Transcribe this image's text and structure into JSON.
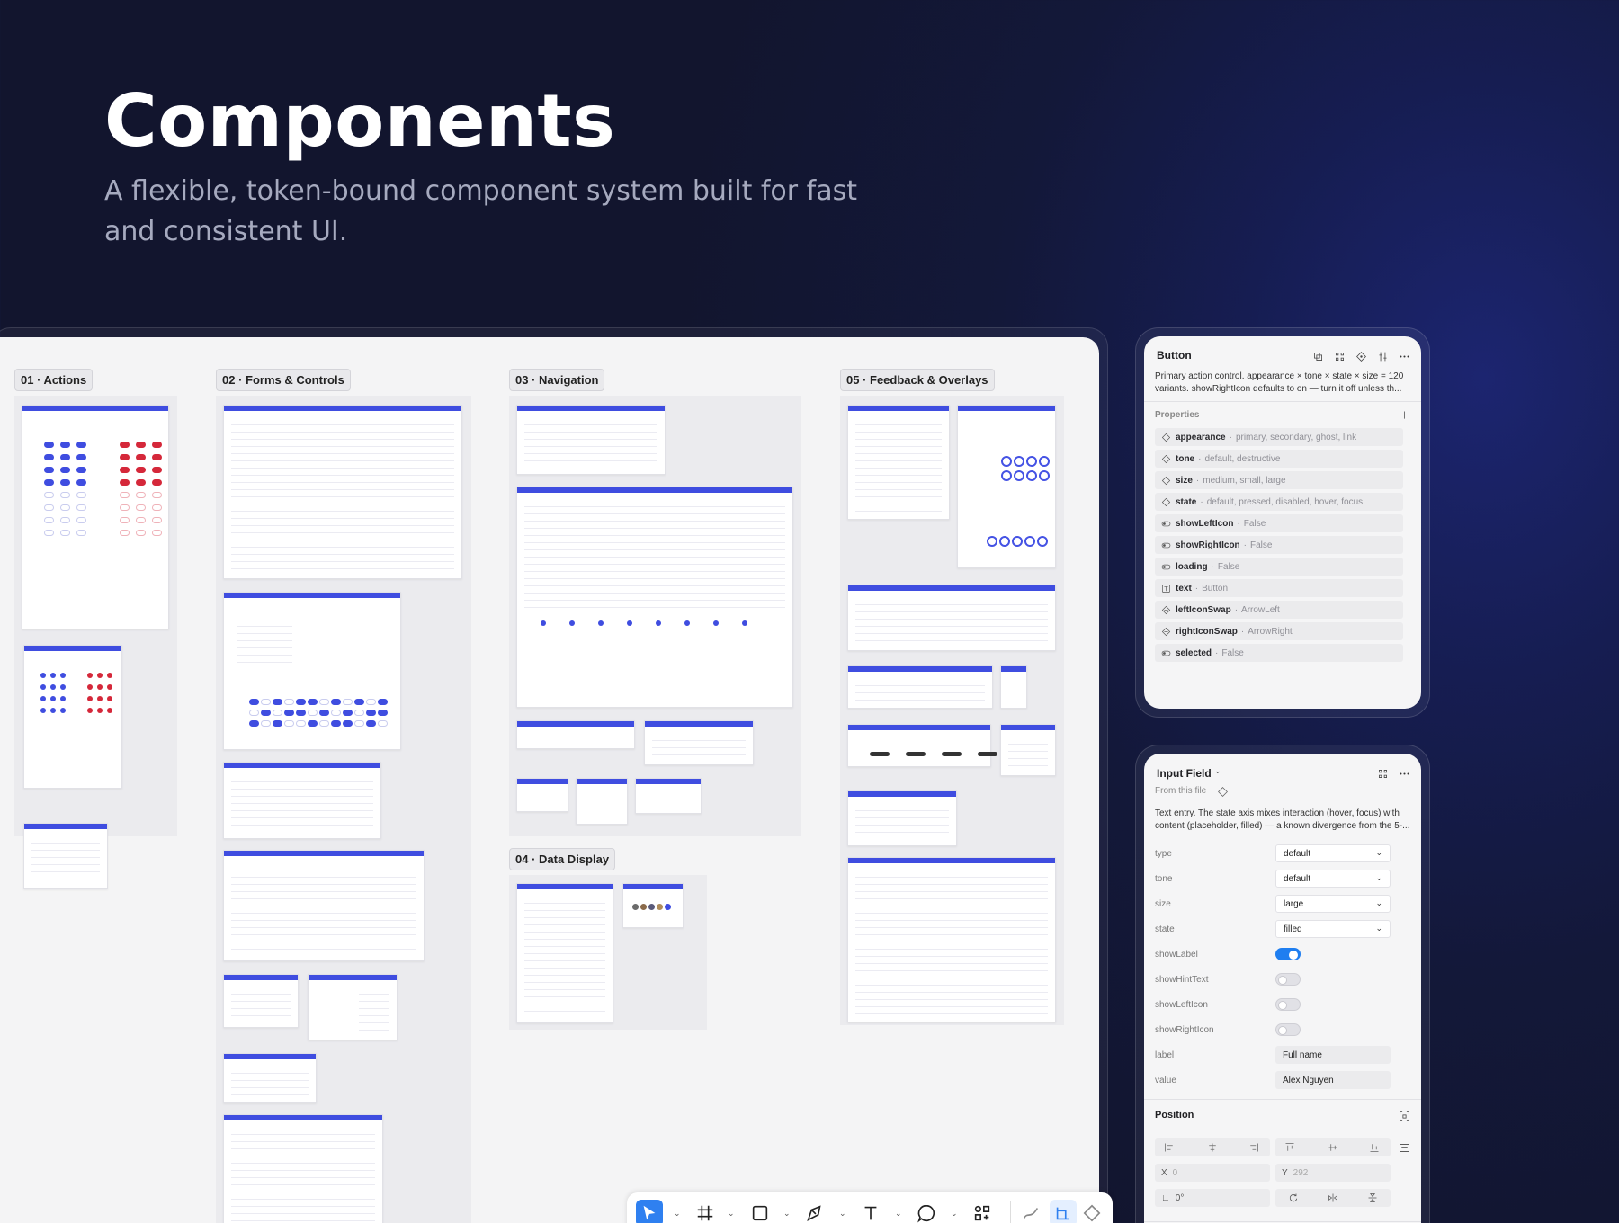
{
  "hero": {
    "title": "Components",
    "subtitle": "A flexible, token-bound component system built for fast and consistent UI."
  },
  "canvas": {
    "sections": [
      {
        "id": "actions",
        "label": "01 · Actions"
      },
      {
        "id": "forms",
        "label": "02 · Forms & Controls"
      },
      {
        "id": "navigation",
        "label": "03 · Navigation"
      },
      {
        "id": "data",
        "label": "04 · Data Display"
      },
      {
        "id": "feedback",
        "label": "05 · Feedback & Overlays"
      }
    ],
    "accent": "#3f4de0",
    "destructive": "#d5283a"
  },
  "toolbar": {
    "tools": [
      "move-tool",
      "frame-tool",
      "shape-tool",
      "pen-tool",
      "text-tool",
      "comment-tool",
      "actions-tool",
      "draw-tool",
      "dev-mode-tool"
    ],
    "active": "move-tool"
  },
  "button_panel": {
    "title": "Button",
    "description": "Primary action control. appearance × tone × state × size = 120 variants. showRightIcon defaults to on — turn it off unless th...",
    "properties_label": "Properties",
    "properties": [
      {
        "icon": "variant-icon",
        "name": "appearance",
        "value": "primary, secondary, ghost, link"
      },
      {
        "icon": "variant-icon",
        "name": "tone",
        "value": "default, destructive"
      },
      {
        "icon": "variant-icon",
        "name": "size",
        "value": "medium, small, large"
      },
      {
        "icon": "variant-icon",
        "name": "state",
        "value": "default, pressed, disabled, hover, focus"
      },
      {
        "icon": "boolean-icon",
        "name": "showLeftIcon",
        "value": "False"
      },
      {
        "icon": "boolean-icon",
        "name": "showRightIcon",
        "value": "False"
      },
      {
        "icon": "boolean-icon",
        "name": "loading",
        "value": "False"
      },
      {
        "icon": "text-icon",
        "name": "text",
        "value": "Button"
      },
      {
        "icon": "swap-icon",
        "name": "leftIconSwap",
        "value": "ArrowLeft"
      },
      {
        "icon": "swap-icon",
        "name": "rightIconSwap",
        "value": "ArrowRight"
      },
      {
        "icon": "boolean-icon",
        "name": "selected",
        "value": "False"
      }
    ]
  },
  "input_panel": {
    "title": "Input Field",
    "source": "From this file",
    "description": "Text entry. The state axis mixes interaction (hover, focus) with content (placeholder, filled) — a known divergence from the 5-...",
    "selects": [
      {
        "label": "type",
        "value": "default"
      },
      {
        "label": "tone",
        "value": "default"
      },
      {
        "label": "size",
        "value": "large"
      },
      {
        "label": "state",
        "value": "filled"
      }
    ],
    "toggles": [
      {
        "label": "showLabel",
        "on": true
      },
      {
        "label": "showHintText",
        "on": false
      },
      {
        "label": "showLeftIcon",
        "on": false
      },
      {
        "label": "showRightIcon",
        "on": false
      }
    ],
    "texts": [
      {
        "label": "label",
        "value": "Full name"
      },
      {
        "label": "value",
        "value": "Alex Nguyen"
      }
    ],
    "position": {
      "title": "Position",
      "x_label": "X",
      "x_value": "0",
      "y_label": "Y",
      "y_value": "292",
      "rotation_value": "0°"
    }
  }
}
